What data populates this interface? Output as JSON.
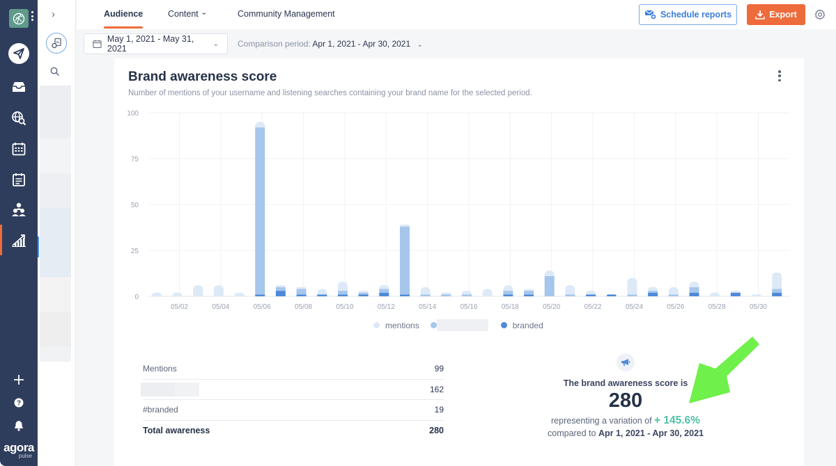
{
  "sidebar": {
    "items": [
      {
        "icon": "paper-plane-icon",
        "label": "Publish"
      },
      {
        "icon": "inbox-icon",
        "label": "Inbox"
      },
      {
        "icon": "globe-search-icon",
        "label": "Listening"
      },
      {
        "icon": "calendar-icon",
        "label": "Calendar"
      },
      {
        "icon": "list-clipboard-icon",
        "label": "Content"
      },
      {
        "icon": "users-icon",
        "label": "Users"
      },
      {
        "icon": "reports-chart-icon",
        "label": "Reports"
      }
    ],
    "bottom": [
      {
        "icon": "plus-icon"
      },
      {
        "icon": "help-icon"
      },
      {
        "icon": "bell-icon"
      }
    ],
    "brand_line1": "agora",
    "brand_line2": "pulse",
    "active_color": "#ef6c3a"
  },
  "subnav": {
    "collapse_glyph": "›"
  },
  "tabs": [
    {
      "label": "Audience",
      "active": true
    },
    {
      "label": "Content",
      "dropdown": true
    },
    {
      "label": "Community Management"
    }
  ],
  "tab_dropdown_glyph": "⌄",
  "toolbar": {
    "schedule_label": "Schedule reports",
    "export_label": "Export",
    "export_color": "#ee6b3b",
    "schedule_color": "#3b7ddd"
  },
  "filters": {
    "date_range": "May 1, 2021 - May 31, 2021",
    "comparison_label": "Comparison period:",
    "comparison_value": "Apr 1, 2021 - Apr 30, 2021"
  },
  "card": {
    "title": "Brand awareness score",
    "subtitle": "Number of mentions of your username and listening searches containing your brand name for the selected period."
  },
  "chart_data": {
    "type": "bar",
    "stacked": true,
    "title": "Brand awareness score",
    "xlabel": "",
    "ylabel": "",
    "ylim": [
      0,
      100
    ],
    "yticks": [
      0,
      25,
      50,
      75,
      100
    ],
    "grid": true,
    "legend_position": "bottom",
    "categories": [
      "05/01",
      "05/02",
      "05/03",
      "05/04",
      "05/05",
      "05/06",
      "05/07",
      "05/08",
      "05/09",
      "05/10",
      "05/11",
      "05/12",
      "05/13",
      "05/14",
      "05/15",
      "05/16",
      "05/17",
      "05/18",
      "05/19",
      "05/20",
      "05/21",
      "05/22",
      "05/23",
      "05/24",
      "05/25",
      "05/26",
      "05/27",
      "05/28",
      "05/29",
      "05/30",
      "05/31"
    ],
    "xtick_labels": [
      "05/02",
      "05/04",
      "05/06",
      "05/08",
      "05/10",
      "05/12",
      "05/14",
      "05/16",
      "05/18",
      "05/20",
      "05/22",
      "05/24",
      "05/26",
      "05/28",
      "05/30"
    ],
    "series": [
      {
        "name": "branded",
        "color": "#4f8ad9",
        "values": [
          0,
          0,
          0,
          0,
          0,
          1,
          3,
          1,
          1,
          1,
          1,
          2,
          1,
          0,
          0,
          0,
          0,
          1,
          1,
          0,
          0,
          1,
          1,
          0,
          2,
          0,
          2,
          0,
          2,
          0,
          2
        ]
      },
      {
        "name": "(redacted)",
        "color": "#a6c6ec",
        "values": [
          0,
          0,
          0,
          0,
          0,
          91,
          2,
          3,
          0,
          2,
          1,
          2,
          37,
          1,
          1,
          1,
          0,
          2,
          2,
          11,
          1,
          0,
          0,
          1,
          1,
          1,
          3,
          0,
          0,
          0,
          2
        ]
      },
      {
        "name": "mentions",
        "color": "#dde9f7",
        "values": [
          2,
          2,
          6,
          6,
          2,
          3,
          1,
          1,
          3,
          5,
          1,
          2,
          1,
          4,
          1,
          2,
          4,
          3,
          1,
          3,
          5,
          2,
          0,
          9,
          2,
          4,
          3,
          2,
          1,
          1,
          9
        ]
      }
    ]
  },
  "legend": [
    {
      "label": "mentions",
      "color": "#dde9f7"
    },
    {
      "label": "",
      "color": "#a6c6ec",
      "redacted": true
    },
    {
      "label": "branded",
      "color": "#4f8ad9"
    }
  ],
  "table": {
    "rows": [
      {
        "label": "Mentions",
        "value": "99"
      },
      {
        "label": "",
        "value": "162",
        "redacted": true
      },
      {
        "label": "#branded",
        "value": "19"
      },
      {
        "label": "Total awareness",
        "value": "280",
        "total": true
      }
    ]
  },
  "summary": {
    "line1": "The brand awareness score is",
    "score": "280",
    "line2_prefix": "representing a variation of",
    "variation": "+ 145.6%",
    "variation_color": "#52c0a8",
    "line3_prefix": "compared to",
    "compare_period": "Apr 1, 2021 - Apr 30, 2021"
  },
  "annotation": {
    "type": "arrow",
    "color": "#6ff04a"
  }
}
